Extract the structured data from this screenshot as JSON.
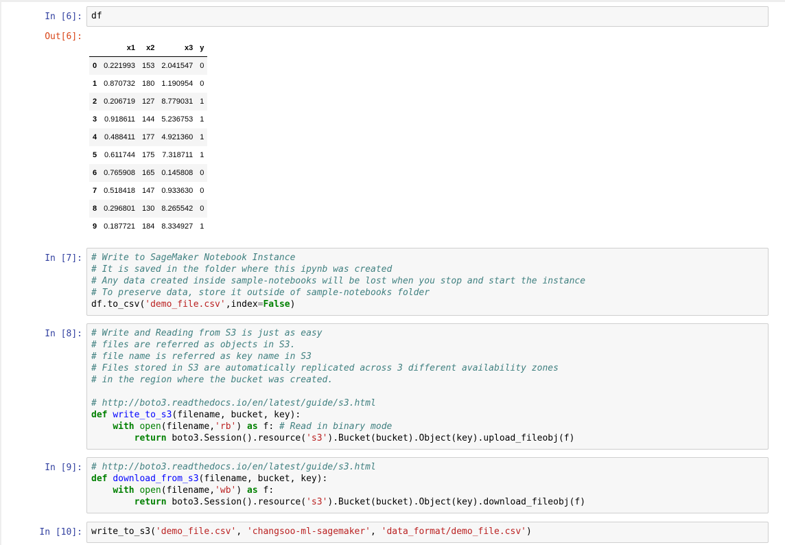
{
  "cells": {
    "c6": {
      "in_prompt": "In [6]:",
      "out_prompt": "Out[6]:",
      "code": "df"
    },
    "c7": {
      "in_prompt": "In [7]:"
    },
    "c8": {
      "in_prompt": "In [8]:"
    },
    "c9": {
      "in_prompt": "In [9]:"
    },
    "c10": {
      "in_prompt": "In [10]:"
    }
  },
  "dataframe": {
    "columns": [
      "x1",
      "x2",
      "x3",
      "y"
    ],
    "rows": [
      {
        "idx": "0",
        "x1": "0.221993",
        "x2": "153",
        "x3": "2.041547",
        "y": "0"
      },
      {
        "idx": "1",
        "x1": "0.870732",
        "x2": "180",
        "x3": "1.190954",
        "y": "0"
      },
      {
        "idx": "2",
        "x1": "0.206719",
        "x2": "127",
        "x3": "8.779031",
        "y": "1"
      },
      {
        "idx": "3",
        "x1": "0.918611",
        "x2": "144",
        "x3": "5.236753",
        "y": "1"
      },
      {
        "idx": "4",
        "x1": "0.488411",
        "x2": "177",
        "x3": "4.921360",
        "y": "1"
      },
      {
        "idx": "5",
        "x1": "0.611744",
        "x2": "175",
        "x3": "7.318711",
        "y": "1"
      },
      {
        "idx": "6",
        "x1": "0.765908",
        "x2": "165",
        "x3": "0.145808",
        "y": "0"
      },
      {
        "idx": "7",
        "x1": "0.518418",
        "x2": "147",
        "x3": "0.933630",
        "y": "0"
      },
      {
        "idx": "8",
        "x1": "0.296801",
        "x2": "130",
        "x3": "8.265542",
        "y": "0"
      },
      {
        "idx": "9",
        "x1": "0.187721",
        "x2": "184",
        "x3": "8.334927",
        "y": "1"
      }
    ]
  },
  "code7": {
    "l1": "# Write to SageMaker Notebook Instance",
    "l2": "# It is saved in the folder where this ipynb was created",
    "l3": "# Any data created inside sample-notebooks will be lost when you stop and start the instance",
    "l4": "# To preserve data, store it outside of sample-notebooks folder",
    "l5_a": "df.to_csv(",
    "l5_s": "'demo_file.csv'",
    "l5_b": ",index",
    "l5_eq": "=",
    "l5_kw": "False",
    "l5_c": ")"
  },
  "code8": {
    "l1": "# Write and Reading from S3 is just as easy",
    "l2": "# files are referred as objects in S3.",
    "l3": "# file name is referred as key name in S3",
    "l4": "# Files stored in S3 are automatically replicated across 3 different availability zones",
    "l5": "# in the region where the bucket was created.",
    "l7": "# http://boto3.readthedocs.io/en/latest/guide/s3.html",
    "def_kw": "def",
    "def_name": "write_to_s3",
    "def_args": "(filename, bucket, key):",
    "with_kw": "with",
    "open_fn": "open",
    "open_args_a": "(filename,",
    "open_mode": "'rb'",
    "open_args_b": ")",
    "as_kw": "as",
    "as_rest": "f:",
    "inline_comment": "# Read in binary mode",
    "return_kw": "return",
    "ret_a": "boto3.Session().resource(",
    "ret_s": "'s3'",
    "ret_b": ").Bucket(bucket).Object(key).upload_fileobj(f)"
  },
  "code9": {
    "l1": "# http://boto3.readthedocs.io/en/latest/guide/s3.html",
    "def_kw": "def",
    "def_name": "download_from_s3",
    "def_args": "(filename, bucket, key):",
    "with_kw": "with",
    "open_fn": "open",
    "open_args_a": "(filename,",
    "open_mode": "'wb'",
    "open_args_b": ")",
    "as_kw": "as",
    "as_rest": "f:",
    "return_kw": "return",
    "ret_a": "boto3.Session().resource(",
    "ret_s": "'s3'",
    "ret_b": ").Bucket(bucket).Object(key).download_fileobj(f)"
  },
  "code10": {
    "fn": "write_to_s3(",
    "s1": "'demo_file.csv'",
    "sep1": ", ",
    "s2": "'changsoo-ml-sagemaker'",
    "sep2": ", ",
    "s3": "'data_format/demo_file.csv'",
    "end": ")"
  }
}
